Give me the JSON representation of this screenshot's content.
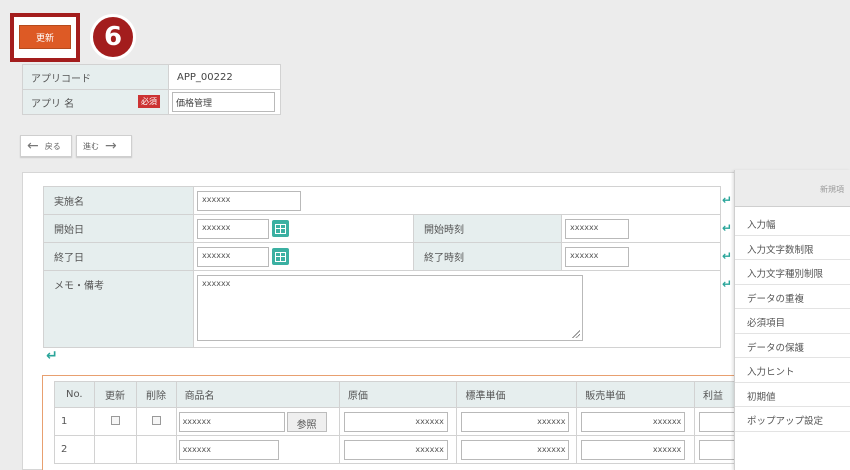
{
  "toolbar": {
    "update_label": "更新",
    "step_number": "6"
  },
  "app_info": {
    "code_label": "アプリコード",
    "code_value": "APP_00222",
    "name_label": "アプリ 名",
    "required_badge": "必須",
    "name_value": "価格管理"
  },
  "nav": {
    "back_label": "戻る",
    "forward_label": "進む"
  },
  "form": {
    "name_label": "実施名",
    "name_value": "xxxxxx",
    "start_date_label": "開始日",
    "start_date_value": "xxxxxx",
    "start_time_label": "開始時刻",
    "start_time_value": "xxxxxx",
    "end_date_label": "終了日",
    "end_date_value": "xxxxxx",
    "end_time_label": "終了時刻",
    "end_time_value": "xxxxxx",
    "memo_label": "メモ・備考",
    "memo_value": "xxxxxx"
  },
  "items_table": {
    "headers": [
      "No.",
      "更新",
      "削除",
      "商品名",
      "原価",
      "標準単価",
      "販売単価",
      "利益"
    ],
    "ref_button": "参照",
    "rows": [
      {
        "no": "1",
        "product": "xxxxxx",
        "cost": "xxxxxx",
        "std_price": "xxxxxx",
        "sale_price": "xxxxxx"
      },
      {
        "no": "2",
        "product": "xxxxxx",
        "cost": "xxxxxx",
        "std_price": "xxxxxx",
        "sale_price": "xxxxxx"
      }
    ]
  },
  "context_menu": {
    "header": "新規項",
    "items": [
      "入力幅",
      "入力文字数制限",
      "入力文字種別制限",
      "データの重複",
      "必須項目",
      "データの保護",
      "入力ヒント",
      "初期値",
      "ポップアップ設定"
    ]
  },
  "colors": {
    "accent_red": "#a31d1d",
    "update_orange": "#dd5a25",
    "teal": "#3bb0a2",
    "label_bg": "#e6eeee"
  }
}
